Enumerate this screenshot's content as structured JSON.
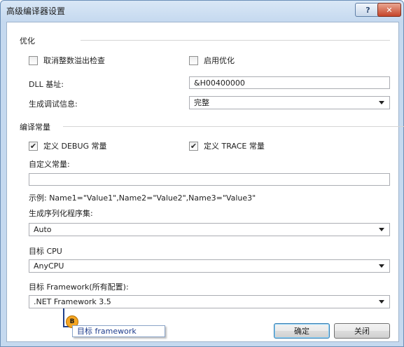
{
  "window": {
    "title": "高级编译器设置",
    "help_button": "?",
    "close_button": "✕"
  },
  "optimization": {
    "section_label": "优化",
    "remove_overflow_checks": {
      "label": "取消整数溢出检查",
      "checked": false
    },
    "enable_optimizations": {
      "label": "启用优化",
      "checked": false
    },
    "dll_base_label": "DLL 基址:",
    "dll_base_value": "&H00400000",
    "debug_info_label": "生成调试信息:",
    "debug_info_value": "完整"
  },
  "constants": {
    "section_label": "编译常量",
    "define_debug": {
      "label": "定义 DEBUG 常量",
      "checked": true
    },
    "define_trace": {
      "label": "定义 TRACE 常量",
      "checked": true
    },
    "custom_label": "自定义常量:",
    "custom_value": "",
    "example_text": "示例:  Name1=\"Value1\",Name2=\"Value2\",Name3=\"Value3\""
  },
  "serialization": {
    "label": "生成序列化程序集:",
    "value": "Auto"
  },
  "target_cpu": {
    "label": "目标 CPU",
    "value": "AnyCPU"
  },
  "target_framework": {
    "label": "目标 Framework(所有配置):",
    "value": ".NET Framework 3.5"
  },
  "callout": {
    "badge": "B",
    "text": "目标 framework"
  },
  "buttons": {
    "ok": "确定",
    "cancel": "关闭"
  },
  "colors": {
    "callout_badge": "#f5a623",
    "callout_line": "#1f3f8a"
  }
}
